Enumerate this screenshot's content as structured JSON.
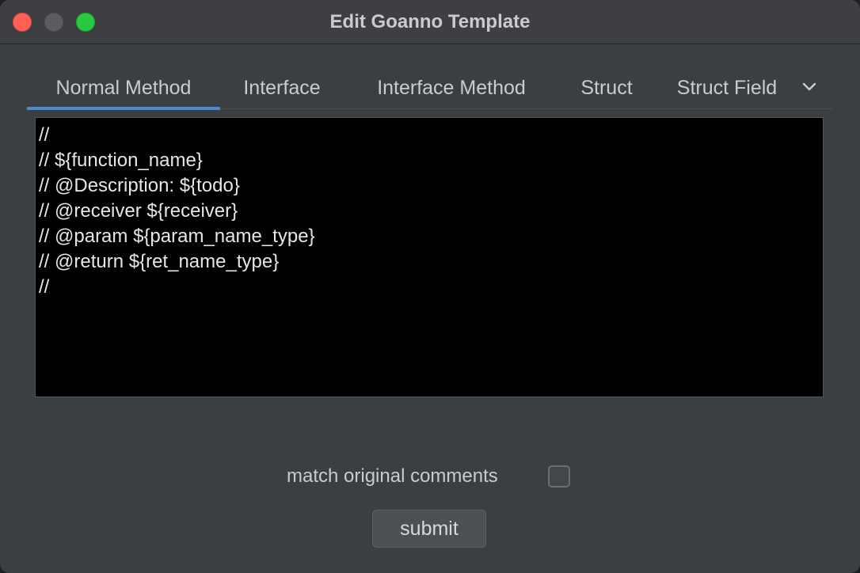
{
  "window": {
    "title": "Edit Goanno Template"
  },
  "tabs": [
    {
      "label": "Normal Method",
      "active": true
    },
    {
      "label": "Interface",
      "active": false
    },
    {
      "label": "Interface Method",
      "active": false
    },
    {
      "label": "Struct",
      "active": false
    },
    {
      "label": "Struct Field",
      "active": false
    }
  ],
  "tabs_overflow_icon": "chevron-down-icon",
  "editor": {
    "lines": [
      "//",
      "// ${function_name}",
      "// @Description: ${todo}",
      "// @receiver ${receiver}",
      "// @param ${param_name_type}",
      "// @return ${ret_name_type}",
      "//"
    ]
  },
  "options": {
    "match_original_comments_label": "match original comments",
    "match_original_comments_checked": false
  },
  "submit": {
    "label": "submit"
  },
  "colors": {
    "accent": "#4a8ad4",
    "close": "#ff5f57",
    "maximize": "#28c840",
    "editor_bg": "#000000"
  }
}
